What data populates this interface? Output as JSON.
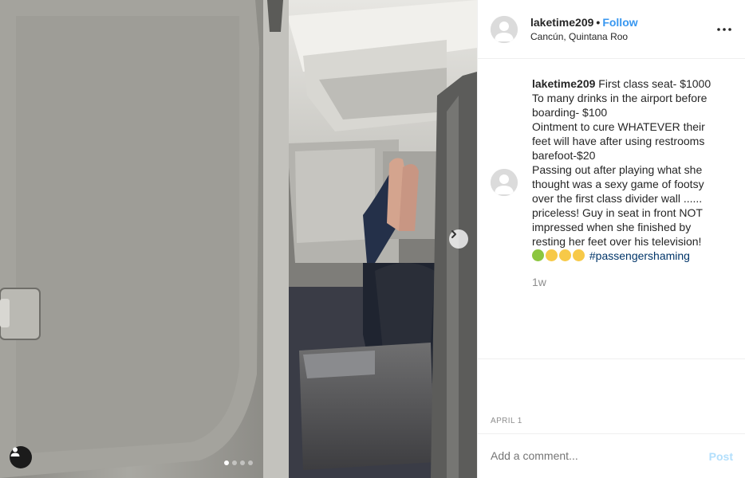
{
  "post": {
    "username": "laketime209",
    "separator": "•",
    "follow_label": "Follow",
    "location": "Cancún, Quintana Roo",
    "more_label": "•••"
  },
  "caption": {
    "username": "laketime209",
    "lines": [
      "First class seat- $1000",
      "To many drinks in the airport before",
      "boarding- $100",
      "Ointment to cure WHATEVER their",
      "feet will have after using restrooms",
      "barefoot-$20",
      "Passing out after playing what she",
      "thought was a sexy game of footsy",
      "over the first class divider wall ......",
      "priceless! Guy in seat in front NOT",
      "impressed when she finished by",
      "resting her feet over his television!"
    ],
    "emojis": [
      "nauseated-face",
      "rolling-on-floor-laughing",
      "rolling-on-floor-laughing",
      "rolling-on-floor-laughing"
    ],
    "hashtag": "#passengershaming",
    "time": "1w"
  },
  "date": "APRIL 1",
  "comment_box": {
    "placeholder": "Add a comment...",
    "post_label": "Post"
  },
  "carousel": {
    "slides": 4,
    "active_index": 0
  },
  "colors": {
    "link": "#3897f0",
    "hashtag": "#003569",
    "post_disabled": "#b2dffc",
    "muted": "#8e8e8e"
  }
}
